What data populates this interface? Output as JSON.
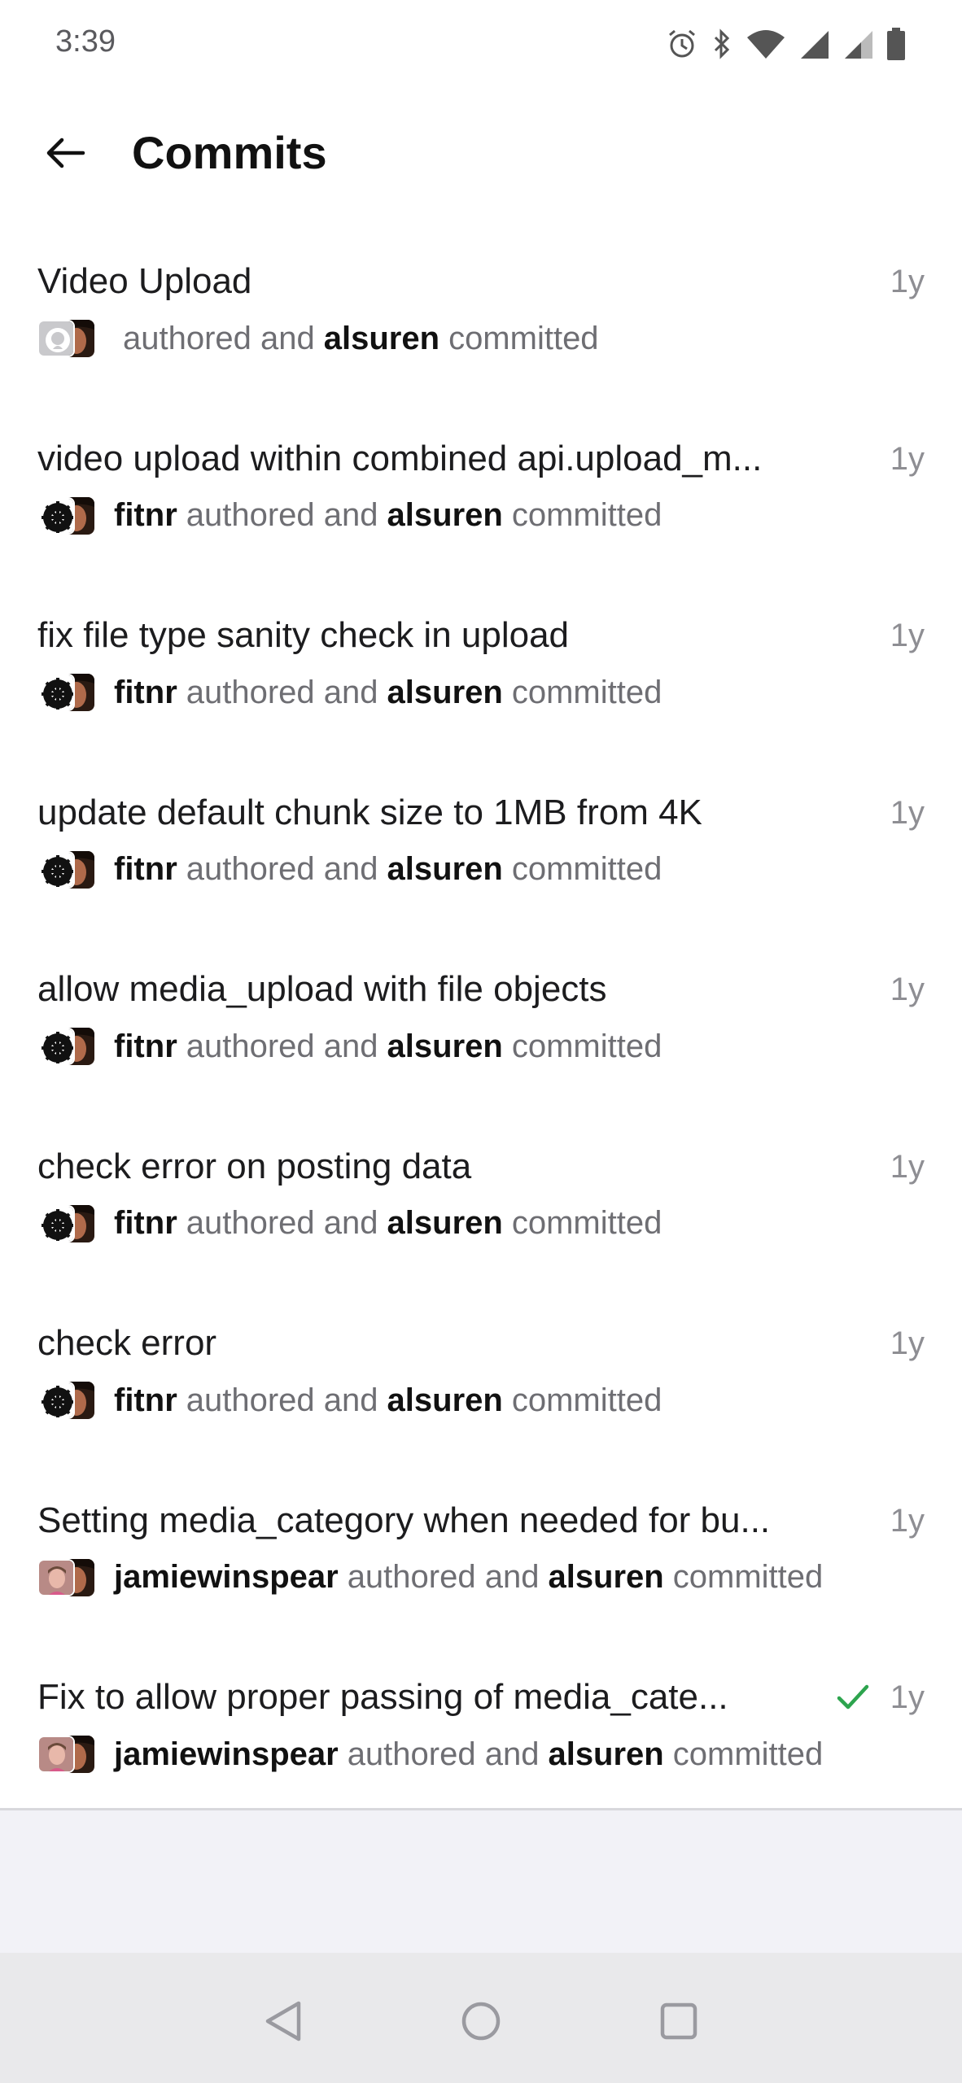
{
  "status_bar": {
    "time": "3:39",
    "icons": [
      "alarm-icon",
      "bluetooth-icon",
      "wifi-icon",
      "signal-icon",
      "signal-icon",
      "battery-icon"
    ]
  },
  "header": {
    "back_icon": "arrow-left-icon",
    "title": "Commits"
  },
  "commits": [
    {
      "message": "Video Upload",
      "author": "",
      "authored_text": "authored and",
      "committer": "alsuren",
      "committed_text": "committed",
      "time": "1y",
      "author_avatar": "github-default-avatar",
      "check": false
    },
    {
      "message": "video upload within combined api.upload_m...",
      "author": "fitnr",
      "authored_text": "authored and",
      "committer": "alsuren",
      "committed_text": "committed",
      "time": "1y",
      "author_avatar": "fitnr-avatar",
      "check": false
    },
    {
      "message": "fix file type sanity check in upload",
      "author": "fitnr",
      "authored_text": "authored and",
      "committer": "alsuren",
      "committed_text": "committed",
      "time": "1y",
      "author_avatar": "fitnr-avatar",
      "check": false
    },
    {
      "message": "update default chunk size to 1MB from 4K",
      "author": "fitnr",
      "authored_text": "authored and",
      "committer": "alsuren",
      "committed_text": "committed",
      "time": "1y",
      "author_avatar": "fitnr-avatar",
      "check": false
    },
    {
      "message": "allow media_upload with file objects",
      "author": "fitnr",
      "authored_text": "authored and",
      "committer": "alsuren",
      "committed_text": "committed",
      "time": "1y",
      "author_avatar": "fitnr-avatar",
      "check": false
    },
    {
      "message": "check error on posting data",
      "author": "fitnr",
      "authored_text": "authored and",
      "committer": "alsuren",
      "committed_text": "committed",
      "time": "1y",
      "author_avatar": "fitnr-avatar",
      "check": false
    },
    {
      "message": "check error",
      "author": "fitnr",
      "authored_text": "authored and",
      "committer": "alsuren",
      "committed_text": "committed",
      "time": "1y",
      "author_avatar": "fitnr-avatar",
      "check": false
    },
    {
      "message": "Setting media_category when needed for bu...",
      "author": "jamiewinspear",
      "authored_text": "authored and",
      "committer": "alsuren",
      "committed_text": "committed",
      "time": "1y",
      "author_avatar": "jamiewinspear-avatar",
      "check": false
    },
    {
      "message": "Fix to allow proper passing of media_cate...",
      "author": "jamiewinspear",
      "authored_text": "authored and",
      "committer": "alsuren",
      "committed_text": "committed",
      "time": "1y",
      "author_avatar": "jamiewinspear-avatar",
      "check": true
    }
  ],
  "colors": {
    "check_green": "#2da44e",
    "muted_text": "#6e6e73",
    "time_text": "#8e8e93"
  },
  "nav_bar": {
    "icons": [
      "nav-back-icon",
      "nav-home-icon",
      "nav-recents-icon"
    ]
  }
}
